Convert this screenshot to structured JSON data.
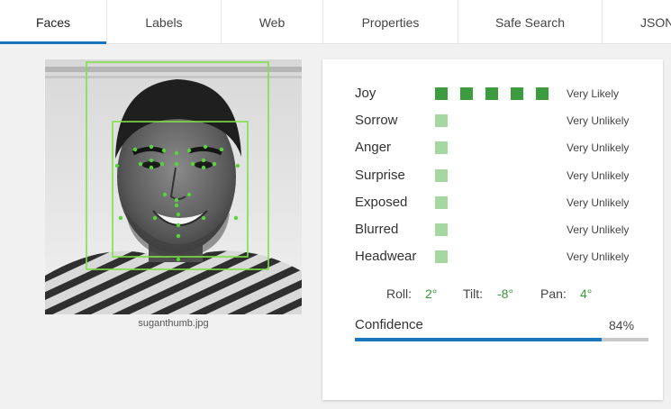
{
  "tabs": [
    {
      "label": "Faces",
      "active": true
    },
    {
      "label": "Labels",
      "active": false
    },
    {
      "label": "Web",
      "active": false
    },
    {
      "label": "Properties",
      "active": false
    },
    {
      "label": "Safe Search",
      "active": false
    },
    {
      "label": "JSON",
      "active": false
    }
  ],
  "image": {
    "filename": "suganthumb.jpg"
  },
  "emotions": [
    {
      "label": "Joy",
      "likelihood": "Very Likely",
      "level": 5
    },
    {
      "label": "Sorrow",
      "likelihood": "Very Unlikely",
      "level": 1
    },
    {
      "label": "Anger",
      "likelihood": "Very Unlikely",
      "level": 1
    },
    {
      "label": "Surprise",
      "likelihood": "Very Unlikely",
      "level": 1
    },
    {
      "label": "Exposed",
      "likelihood": "Very Unlikely",
      "level": 1
    },
    {
      "label": "Blurred",
      "likelihood": "Very Unlikely",
      "level": 1
    },
    {
      "label": "Headwear",
      "likelihood": "Very Unlikely",
      "level": 1
    }
  ],
  "angles": {
    "roll_label": "Roll:",
    "roll": "2°",
    "tilt_label": "Tilt:",
    "tilt": "-8°",
    "pan_label": "Pan:",
    "pan": "4°"
  },
  "confidence": {
    "label": "Confidence",
    "value": "84%",
    "fraction": 0.84
  },
  "colors": {
    "accent": "#1a73b8",
    "strong": "#3d9c3d",
    "weak": "#a4d7a2",
    "box": "#7fe04a",
    "landmark": "#56d43a"
  }
}
